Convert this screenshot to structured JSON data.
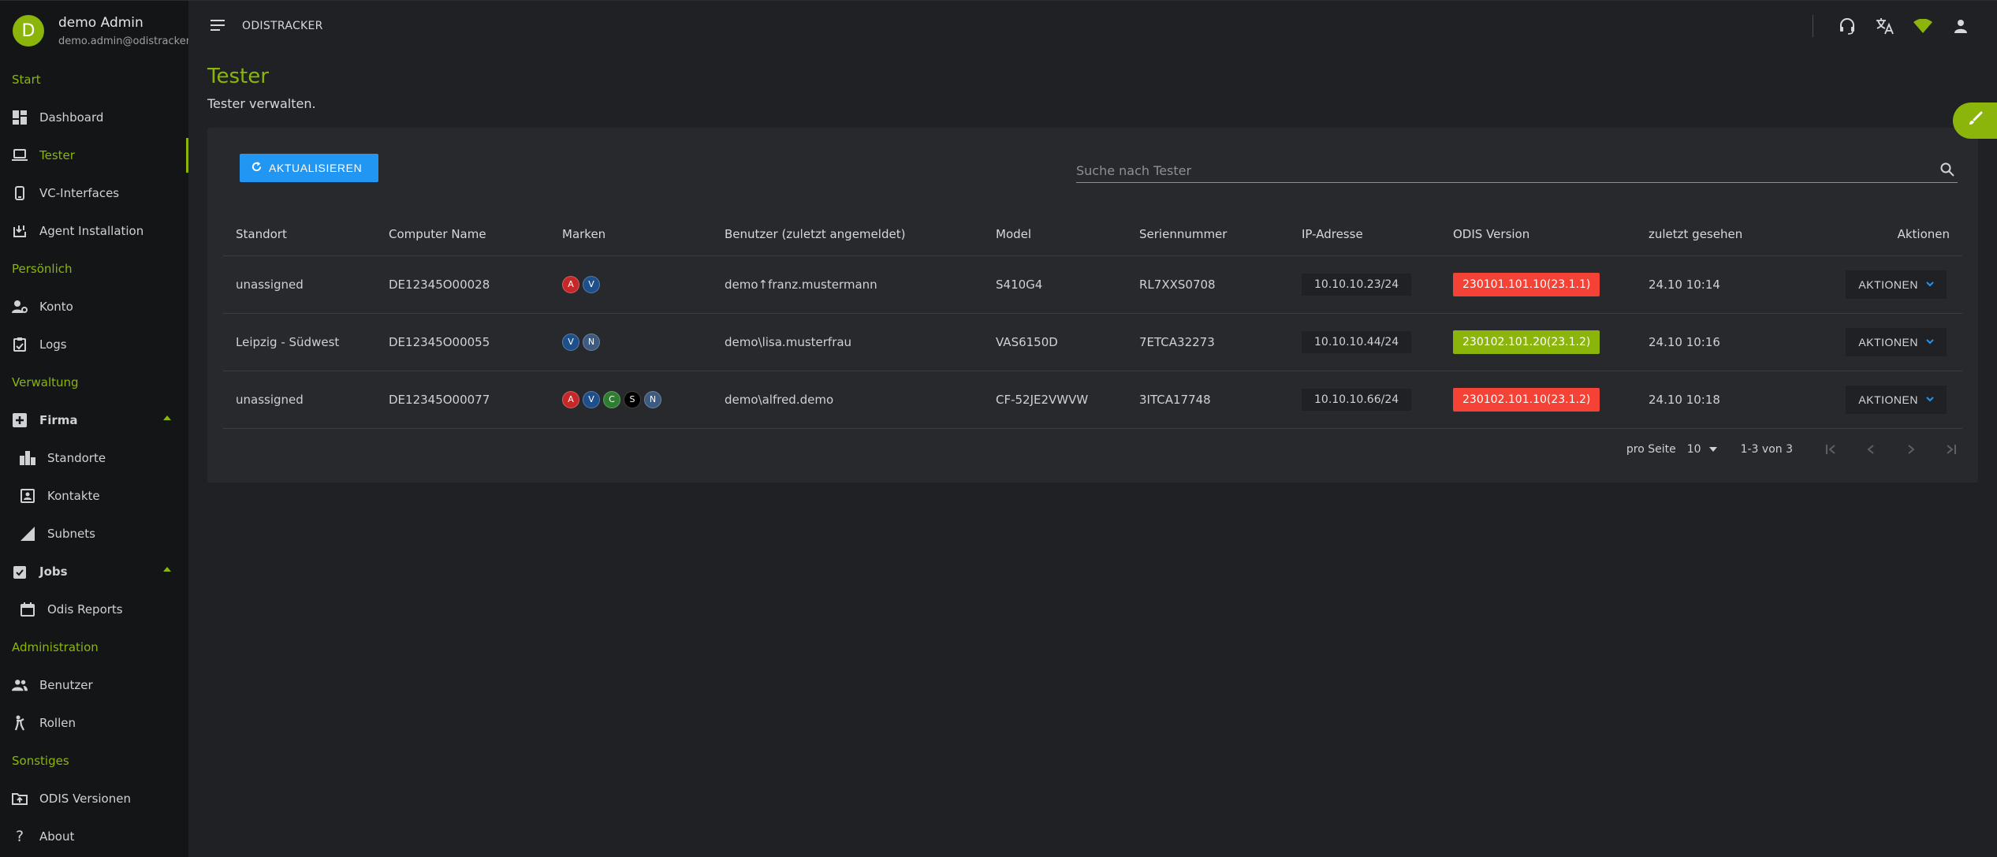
{
  "user": {
    "avatar_letter": "D",
    "name": "demo Admin",
    "email": "demo.admin@odistracker"
  },
  "sidebar": {
    "sections": [
      {
        "label": "Start",
        "items": [
          {
            "label": "Dashboard",
            "icon": "dashboard-icon"
          },
          {
            "label": "Tester",
            "icon": "laptop-icon",
            "active": true
          },
          {
            "label": "VC-Interfaces",
            "icon": "cellphone-icon"
          },
          {
            "label": "Agent Installation",
            "icon": "install-icon"
          }
        ]
      },
      {
        "label": "Persönlich",
        "items": [
          {
            "label": "Konto",
            "icon": "account-cog-icon"
          },
          {
            "label": "Logs",
            "icon": "clipboard-icon"
          }
        ]
      },
      {
        "label": "Verwaltung",
        "items": [
          {
            "label": "Firma",
            "icon": "plus-box-icon",
            "expanded": true
          },
          {
            "label": "Standorte",
            "icon": "city-icon"
          },
          {
            "label": "Kontakte",
            "icon": "contacts-icon"
          },
          {
            "label": "Subnets",
            "icon": "signal-icon"
          },
          {
            "label": "Jobs",
            "icon": "clipboard-check-icon",
            "expanded": true
          },
          {
            "label": "Odis Reports",
            "icon": "calendar-icon"
          }
        ]
      },
      {
        "label": "Administration",
        "items": [
          {
            "label": "Benutzer",
            "icon": "users-icon"
          },
          {
            "label": "Rollen",
            "icon": "roles-icon"
          }
        ]
      },
      {
        "label": "Sonstiges",
        "items": [
          {
            "label": "ODIS Versionen",
            "icon": "folder-upload-icon"
          },
          {
            "label": "About",
            "icon": "question-icon"
          }
        ]
      }
    ]
  },
  "topbar": {
    "app_title": "ODISTRACKER",
    "icons": [
      "headset-icon",
      "translate-icon",
      "wifi-icon",
      "account-icon"
    ]
  },
  "page": {
    "title": "Tester",
    "subtitle": "Tester verwalten."
  },
  "toolbar": {
    "refresh_label": "AKTUALISIEREN",
    "search_placeholder": "Suche nach Tester"
  },
  "table": {
    "headers": [
      "Standort",
      "Computer Name",
      "Marken",
      "Benutzer (zuletzt angemeldet)",
      "Model",
      "Seriennummer",
      "IP-Adresse",
      "ODIS Version",
      "zuletzt gesehen",
      "Aktionen"
    ],
    "action_label": "AKTIONEN",
    "rows": [
      {
        "standort": "unassigned",
        "computer": "DE12345O00028",
        "brands": [
          {
            "letter": "A",
            "color": "#c62828"
          },
          {
            "letter": "V",
            "color": "#1e4f8a"
          }
        ],
        "user": "demo↑franz.mustermann",
        "model": "S410G4",
        "serial": "RL7XXS0708",
        "ip": "10.10.10.23/24",
        "odis": "230101.101.10(23.1.1)",
        "odis_color": "#f44336",
        "seen": "24.10 10:14"
      },
      {
        "standort": "Leipzig - Südwest",
        "computer": "DE12345O00055",
        "brands": [
          {
            "letter": "V",
            "color": "#1e4f8a"
          },
          {
            "letter": "N",
            "color": "#3d5a80"
          }
        ],
        "user": "demo\\lisa.musterfrau",
        "model": "VAS6150D",
        "serial": "7ETCA32273",
        "ip": "10.10.10.44/24",
        "odis": "230102.101.20(23.1.2)",
        "odis_color": "#8bb50b",
        "seen": "24.10 10:16"
      },
      {
        "standort": "unassigned",
        "computer": "DE12345O00077",
        "brands": [
          {
            "letter": "A",
            "color": "#c62828"
          },
          {
            "letter": "V",
            "color": "#1e4f8a"
          },
          {
            "letter": "C",
            "color": "#2e7d32"
          },
          {
            "letter": "S",
            "color": "#000000"
          },
          {
            "letter": "N",
            "color": "#3d5a80"
          }
        ],
        "user": "demo\\alfred.demo",
        "model": "CF-52JE2VWVW",
        "serial": "3ITCA17748",
        "ip": "10.10.10.66/24",
        "odis": "230102.101.10(23.1.2)",
        "odis_color": "#f44336",
        "seen": "24.10 10:18"
      }
    ]
  },
  "pagination": {
    "per_page_label": "pro Seite",
    "per_page_value": "10",
    "range_label": "1-3 von 3"
  },
  "colors": {
    "accent": "#8bb50b",
    "primary_button": "#2196f3",
    "error": "#f44336"
  }
}
